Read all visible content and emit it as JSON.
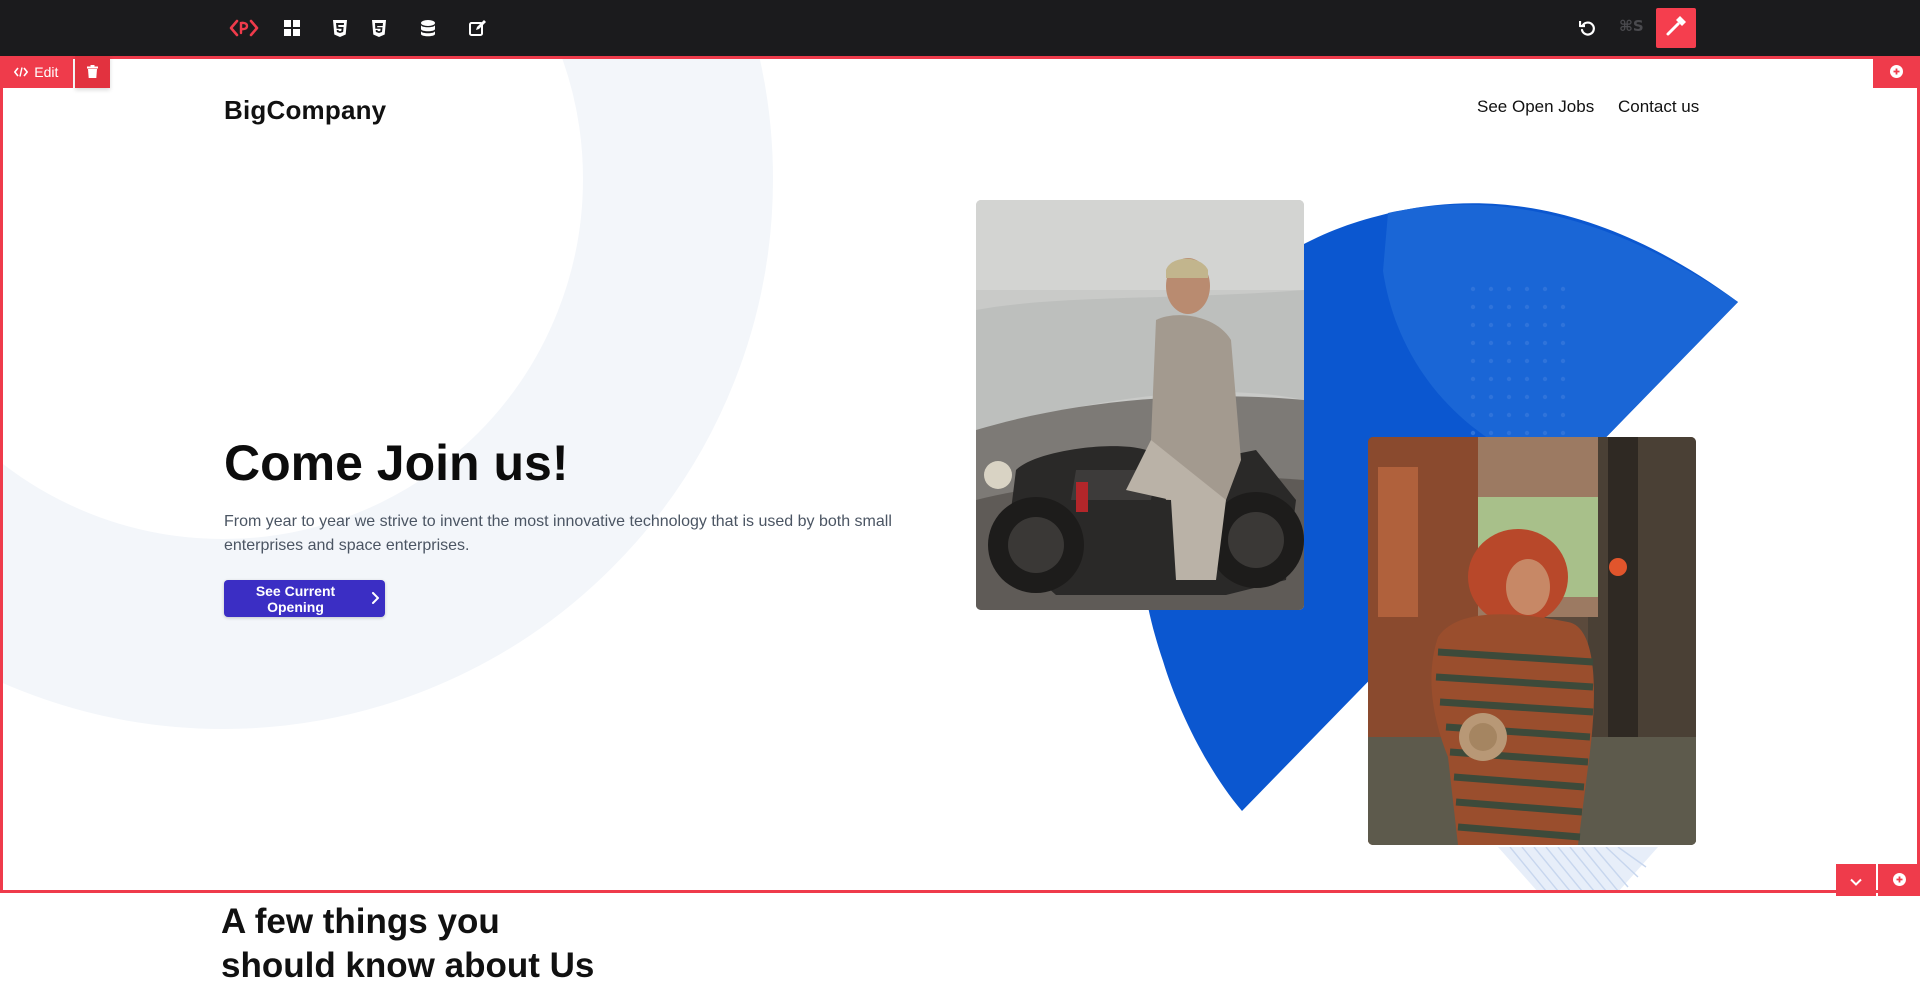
{
  "toolbar": {
    "icons": [
      "code-logo-icon",
      "blocks-icon",
      "html5-icon",
      "css3-icon",
      "database-icon",
      "edit-page-icon",
      "undo-icon",
      "hammer-icon"
    ],
    "save_shortcut": "⌘S"
  },
  "section_controls": {
    "edit_label": "Edit"
  },
  "page": {
    "brand": "BigCompany",
    "nav": [
      "See Open Jobs",
      "Contact us"
    ],
    "hero": {
      "title": "Come Join us!",
      "text": "From year to year we strive to invent the most innovative technology that is used by both small enterprises and space enterprises.",
      "cta_label": "See Current Opening"
    },
    "next_section": {
      "heading_line1": "A few things you",
      "heading_line2": "should know about Us"
    }
  },
  "colors": {
    "toolbar_bg": "#1b1b1d",
    "accent_red": "#ef3b4b",
    "cta_bg": "#3b2ec4",
    "shape_blue": "#0b57d0"
  }
}
